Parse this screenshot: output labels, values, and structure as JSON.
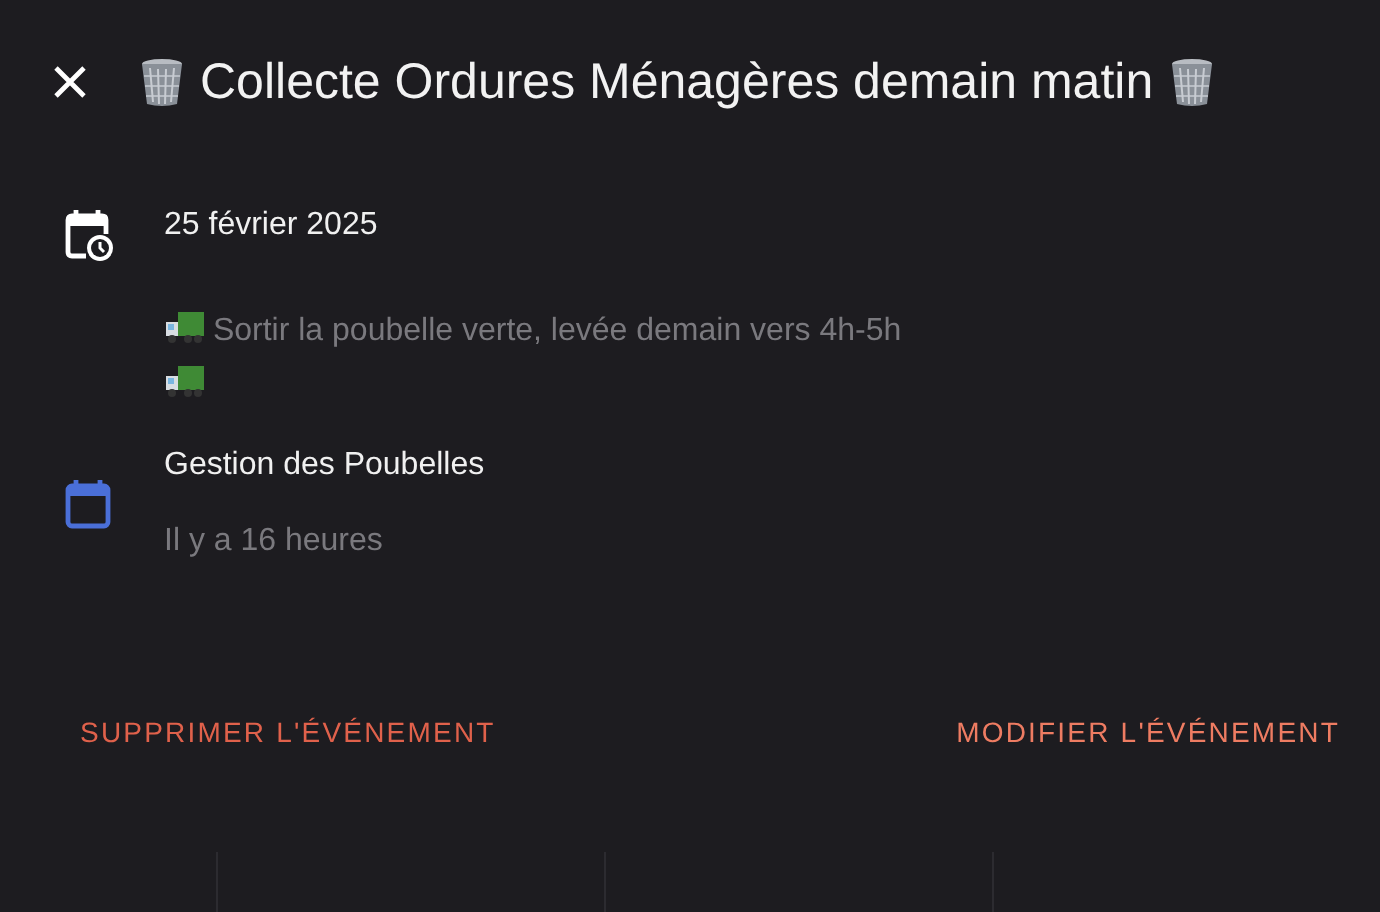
{
  "dialog": {
    "title": "Collecte Ordures Ménagères demain matin"
  },
  "date": "25 février 2025",
  "description": "Sortir la poubelle verte, levée demain vers 4h-5h",
  "calendar": {
    "name": "Gestion des Poubelles",
    "color": "#4a6fd8",
    "updated": "Il y a 16 heures"
  },
  "actions": [
    {
      "label": "SUPPRIMER L'ÉVÉNEMENT",
      "kind": "danger"
    },
    {
      "label": "MODIFIER L'ÉVÉNEMENT",
      "kind": "primary"
    }
  ]
}
